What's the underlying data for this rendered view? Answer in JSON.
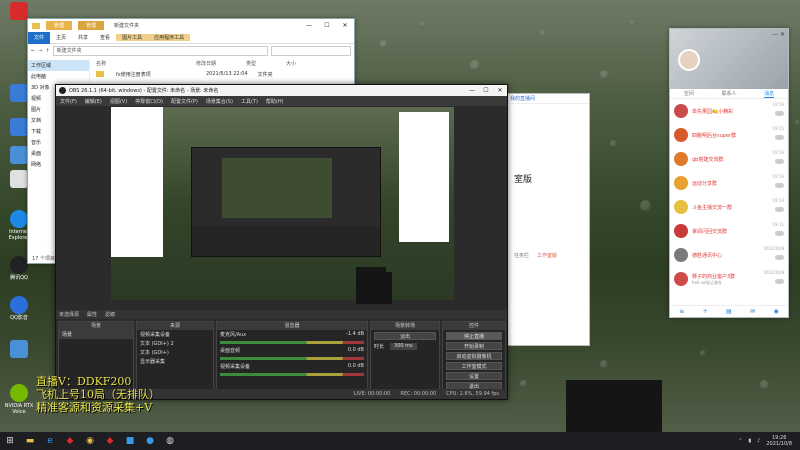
{
  "desktop": {
    "icons": [
      {
        "label": "",
        "color": "#d62c2c"
      },
      {
        "label": "",
        "color": "#3a7bd5"
      },
      {
        "label": "",
        "color": "#3a7bd5"
      },
      {
        "label": "",
        "color": "#4a90d9"
      },
      {
        "label": "",
        "color": "#e0e0e0"
      },
      {
        "label": "Internet Explorer",
        "color": "#1e88e5"
      },
      {
        "label": "腾讯QQ",
        "color": "#222222"
      },
      {
        "label": "QQ影音",
        "color": "#2a6fdb"
      },
      {
        "label": "",
        "color": "#4a90d9"
      },
      {
        "label": "NVIDIA RTX Voice",
        "color": "#76b900"
      }
    ]
  },
  "explorer": {
    "tab_label_1": "管理",
    "tab_label_2": "管理",
    "title": "新建文件夹",
    "ribbon": [
      "文件",
      "主页",
      "共享",
      "查看",
      "图片工具",
      "应用程序工具"
    ],
    "address": "新建文件夹",
    "sidebar": [
      "工作区域",
      "此电脑",
      "3D 对象",
      "视频",
      "图片",
      "文档",
      "下载",
      "音乐",
      "桌面",
      "网络"
    ],
    "columns": [
      "名称",
      "修改日期",
      "类型",
      "大小"
    ],
    "rows": [
      {
        "name": "fx使用注册表项",
        "date": "2021/6/13 22:04",
        "type": "文件夹",
        "size": ""
      }
    ],
    "status": "17 个项目"
  },
  "obs": {
    "title": "OBS 26.1.1 (64-bit, windows) - 配置文件: 未命名 - 场景: 未命名",
    "menu": [
      "文件(F)",
      "编辑(E)",
      "视图(V)",
      "停靠窗口(D)",
      "配置文件(P)",
      "场景集合(S)",
      "工具(T)",
      "帮助(H)"
    ],
    "source_bar": [
      "未选择源",
      "属性",
      "滤镜"
    ],
    "docks": {
      "scenes": {
        "title": "场景",
        "items": [
          "场景"
        ]
      },
      "sources": {
        "title": "来源",
        "items": [
          "视频采集设备",
          "文本 (GDI+) 2",
          "文本 (GDI+)",
          "显示器采集"
        ]
      },
      "mixer": {
        "title": "混音器",
        "tracks": [
          {
            "name": "麦克风/Aux",
            "db": "-1.4 dB"
          },
          {
            "name": "桌面音频",
            "db": "0.0 dB"
          },
          {
            "name": "视频采集设备",
            "db": "0.0 dB"
          }
        ]
      },
      "transitions": {
        "title": "场景转场",
        "type": "淡出",
        "duration_label": "时长",
        "duration": "300 ms"
      },
      "controls": {
        "title": "控件",
        "buttons": [
          "停止直播",
          "开始录制",
          "启动虚拟摄像机",
          "工作室模式",
          "设置",
          "退出"
        ]
      }
    },
    "status": [
      "LIVE: 00:00:00",
      "REC: 00:00:00",
      "CPU: 2.6%, 59.94 fps"
    ]
  },
  "work_panel": {
    "top_label": "我的直播间",
    "heading": "室版",
    "links": [
      "任务栏",
      "工作室版"
    ]
  },
  "qq": {
    "tabs": [
      "空间",
      "联系人",
      "消息"
    ],
    "messages": [
      {
        "name": "单先果园🍋小精彩",
        "msg": "",
        "time": "19:16",
        "color": "#c94a4a"
      },
      {
        "name": "四胞明后台super群",
        "msg": "",
        "time": "19:15",
        "color": "#d85a2a"
      },
      {
        "name": "qb搭建交流群",
        "msg": "",
        "time": "19:16",
        "color": "#e07a2a"
      },
      {
        "name": "运动分享群",
        "msg": "",
        "time": "19:16",
        "color": "#e8a030"
      },
      {
        "name": "斗鱼主播交流一群",
        "msg": "",
        "time": "19:14",
        "color": "#e8c040"
      },
      {
        "name": "掌阅闪回交流群",
        "msg": "",
        "time": "19:11",
        "color": "#c93a3a"
      },
      {
        "name": "德胜通讯中心",
        "msg": "",
        "time": "2021/10/8",
        "color": "#7a7a7a"
      },
      {
        "name": "狮子的商业客户3群",
        "msg": "hell no啦认准啦",
        "time": "2021/10/8",
        "color": "#d04a4a"
      }
    ]
  },
  "overlay": [
    "直播V：DDKF200",
    "飞机上号10局（无排队）",
    "精准客源和资源采集+V"
  ],
  "taskbar": {
    "time": "19:26",
    "date": "2021/10/8"
  }
}
